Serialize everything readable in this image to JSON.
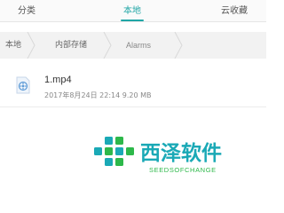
{
  "tabs": [
    {
      "label": "分类"
    },
    {
      "label": "本地",
      "active": true
    },
    {
      "label": "云收藏"
    }
  ],
  "breadcrumb": {
    "items": [
      "本地",
      "内部存储",
      "Alarms"
    ]
  },
  "files": [
    {
      "name": "1.mp4",
      "date": "2017年8月24日 22:14",
      "size": "9.20 MB",
      "icon": "video-file-icon"
    }
  ],
  "watermark": {
    "title": "西泽软件",
    "subtitle": "SEEDSOFCHANGE"
  },
  "colors": {
    "accent": "#20a6a6",
    "logo_teal": "#1aa9b6",
    "logo_green": "#2db84a"
  }
}
